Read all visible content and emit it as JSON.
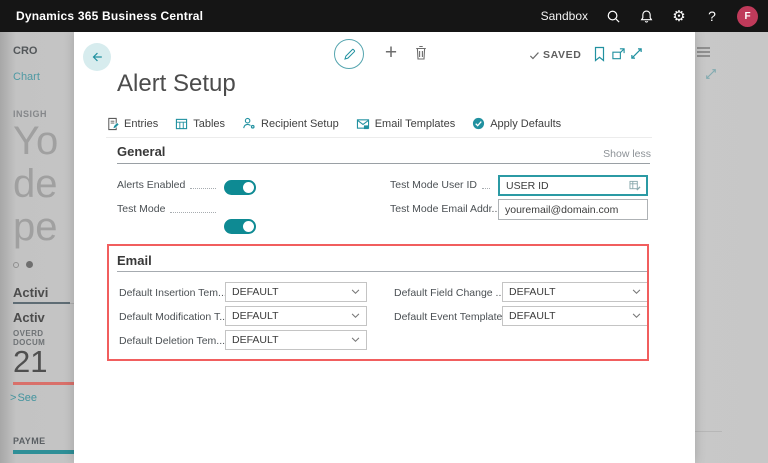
{
  "topbar": {
    "app_title": "Dynamics 365 Business Central",
    "environment": "Sandbox",
    "help_label": "?",
    "avatar_initial": "F"
  },
  "background": {
    "company_heading": "CRO",
    "chart_link": "Chart",
    "insights_label": "INSIGH",
    "headline_lines": {
      "0": "Yo",
      "1": "de",
      "2": "pe"
    },
    "activities_tab": "Activi",
    "activities_heading": "Activ",
    "overdue_caption_line1": "OVERD",
    "overdue_caption_line2": "DOCUM",
    "overdue_value": "21",
    "see_chevron": ">",
    "see_link": "See",
    "payments_label": "PAYME"
  },
  "dialog": {
    "title": "Alert Setup",
    "saved_label": "SAVED",
    "add_label": "+",
    "actions": [
      {
        "label": "Entries"
      },
      {
        "label": "Tables"
      },
      {
        "label": "Recipient Setup"
      },
      {
        "label": "Email Templates"
      },
      {
        "label": "Apply Defaults"
      }
    ],
    "general": {
      "heading": "General",
      "show_less": "Show less",
      "alerts_enabled_label": "Alerts Enabled",
      "test_mode_label": "Test Mode",
      "user_id_label": "Test Mode User ID",
      "user_id_value": "USER ID",
      "email_addr_label": "Test Mode Email Addr...",
      "email_addr_value": "youremail@domain.com"
    },
    "email": {
      "heading": "Email",
      "fields": [
        {
          "label": "Default Insertion Tem...",
          "value": "DEFAULT"
        },
        {
          "label": "Default Modification T...",
          "value": "DEFAULT"
        },
        {
          "label": "Default Deletion Tem...",
          "value": "DEFAULT"
        },
        {
          "label": "Default Field Change ...",
          "value": "DEFAULT"
        },
        {
          "label": "Default Event Template",
          "value": "DEFAULT"
        }
      ]
    }
  },
  "colors": {
    "accent_teal": "#0e8a93",
    "icon_teal": "#2191a0",
    "annotation_red": "#f15e5e",
    "avatar_bg": "#bf3a5a",
    "overdue_bar_red": "#d9706a",
    "payments_bar_teal": "#2e8f97",
    "topbar_bg": "#151515"
  }
}
